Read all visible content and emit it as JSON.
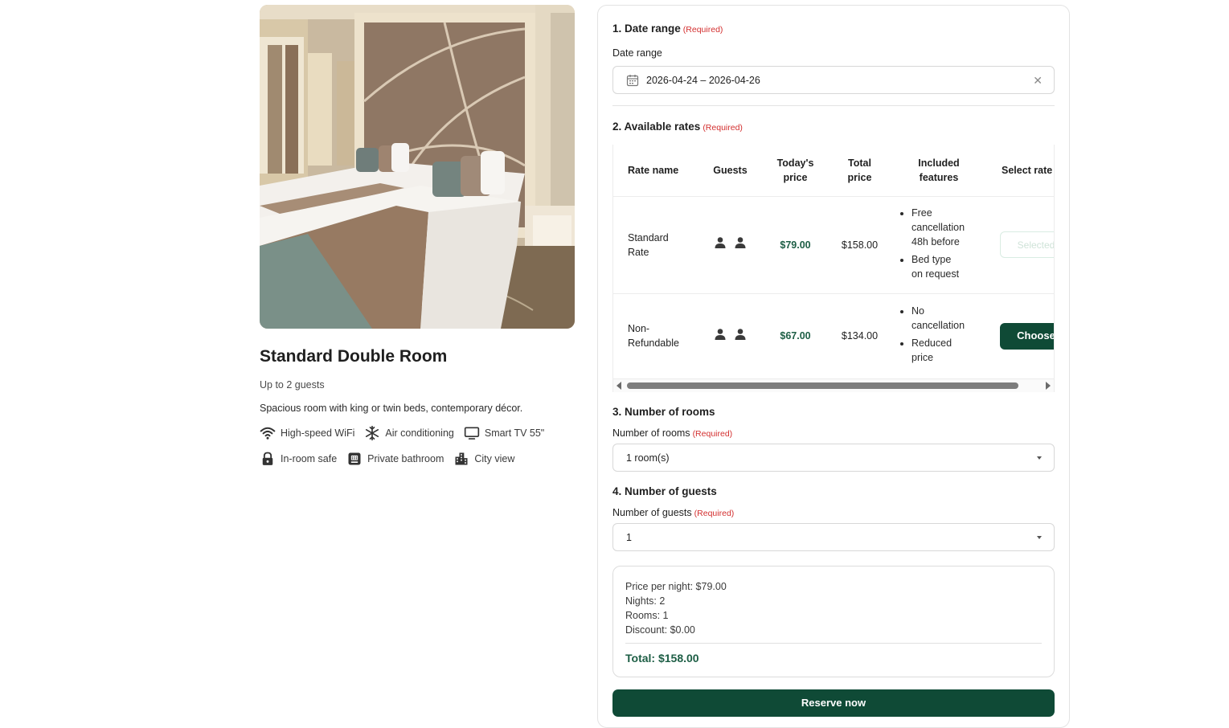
{
  "room": {
    "title": "Standard Double Room",
    "capacity": "Up to 2 guests",
    "description": "Spacious room with king or twin beds, contemporary décor.",
    "amenities": [
      {
        "icon": "wifi-icon",
        "label": "High-speed WiFi"
      },
      {
        "icon": "snowflake-icon",
        "label": "Air conditioning"
      },
      {
        "icon": "tv-icon",
        "label": "Smart TV 55\""
      },
      {
        "icon": "lock-icon",
        "label": "In-room safe"
      },
      {
        "icon": "bathroom-icon",
        "label": "Private bathroom"
      },
      {
        "icon": "city-icon",
        "label": "City view"
      }
    ]
  },
  "required_label": "(Required)",
  "date_section": {
    "title": "1. Date range",
    "label": "Date range",
    "value": "2026-04-24 – 2026-04-26",
    "clear_icon": "close-icon"
  },
  "rates_section": {
    "title": "2. Available rates",
    "headers": {
      "name": "Rate name",
      "guests": "Guests",
      "today_1": "Today's",
      "today_2": "price",
      "total_1": "Total",
      "total_2": "price",
      "features_1": "Included",
      "features_2": "features",
      "select": "Select rate"
    },
    "rates": [
      {
        "name_1": "Standard",
        "name_2": "Rate",
        "guests_icons": 2,
        "today_price": "$79.00",
        "total_price": "$158.00",
        "features": [
          [
            "Free",
            "cancellation",
            "48h before"
          ],
          [
            "Bed type",
            "on request"
          ]
        ],
        "button": "Selected",
        "selected": true
      },
      {
        "name_1": "Non-",
        "name_2": "Refundable",
        "guests_icons": 2,
        "today_price": "$67.00",
        "total_price": "$134.00",
        "features": [
          [
            "No",
            "cancellation"
          ],
          [
            "Reduced",
            "price"
          ]
        ],
        "button": "Choose",
        "selected": false
      }
    ]
  },
  "rooms_section": {
    "title": "3. Number of rooms",
    "label": "Number of rooms",
    "value": "1 room(s)"
  },
  "guests_section": {
    "title": "4. Number of guests",
    "label": "Number of guests",
    "value": "1"
  },
  "summary": {
    "price_per_night": "Price per night: $79.00",
    "nights": "Nights: 2",
    "rooms": "Rooms: 1",
    "discount": "Discount: $0.00",
    "total": "Total: $158.00"
  },
  "reserve_button": "Reserve now",
  "colors": {
    "brand": "#0f4a36",
    "price_green": "#1d5e45",
    "required_red": "#d32f2f"
  }
}
